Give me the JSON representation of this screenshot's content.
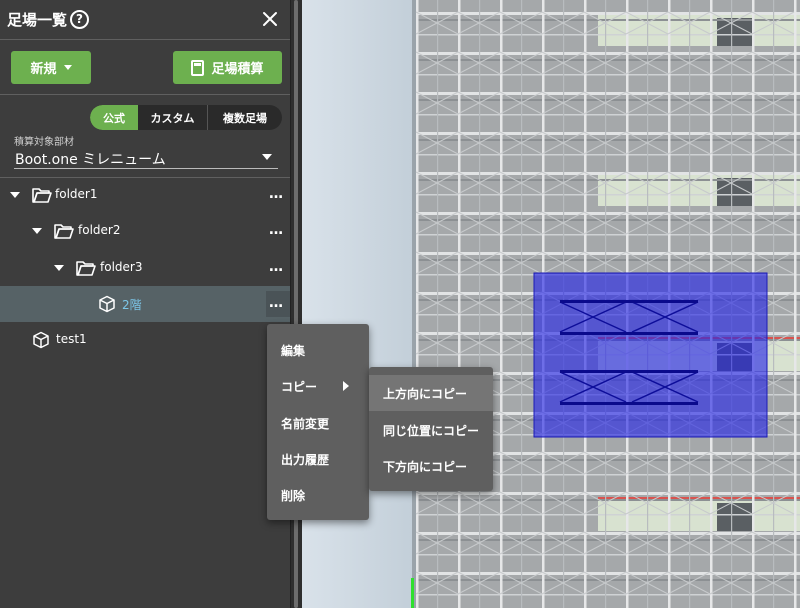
{
  "panel": {
    "title": "足場一覧",
    "new_button": "新規",
    "estimate_button": "足場積算",
    "tabs": [
      "公式",
      "カスタム",
      "複数足場"
    ],
    "material_label": "積算対象部材",
    "material_value": "Boot.one ミレニューム"
  },
  "tree": {
    "items": [
      {
        "label": "folder1",
        "type": "folder",
        "expanded": true
      },
      {
        "label": "folder2",
        "type": "folder",
        "expanded": true
      },
      {
        "label": "folder3",
        "type": "folder",
        "expanded": true
      },
      {
        "label": "2階",
        "type": "model",
        "selected": true
      },
      {
        "label": "test1",
        "type": "model"
      }
    ],
    "more_label": "…"
  },
  "context_menu": {
    "items": [
      "編集",
      "コピー",
      "名前変更",
      "出力履歴",
      "削除"
    ]
  },
  "copy_submenu": {
    "items": [
      "上方向にコピー",
      "同じ位置にコピー",
      "下方向にコピー"
    ]
  },
  "colors": {
    "accent": "#6db04f",
    "panel_bg": "#3d3d3d",
    "selection": "#566266",
    "highlight_box": "#2a2ad8"
  }
}
